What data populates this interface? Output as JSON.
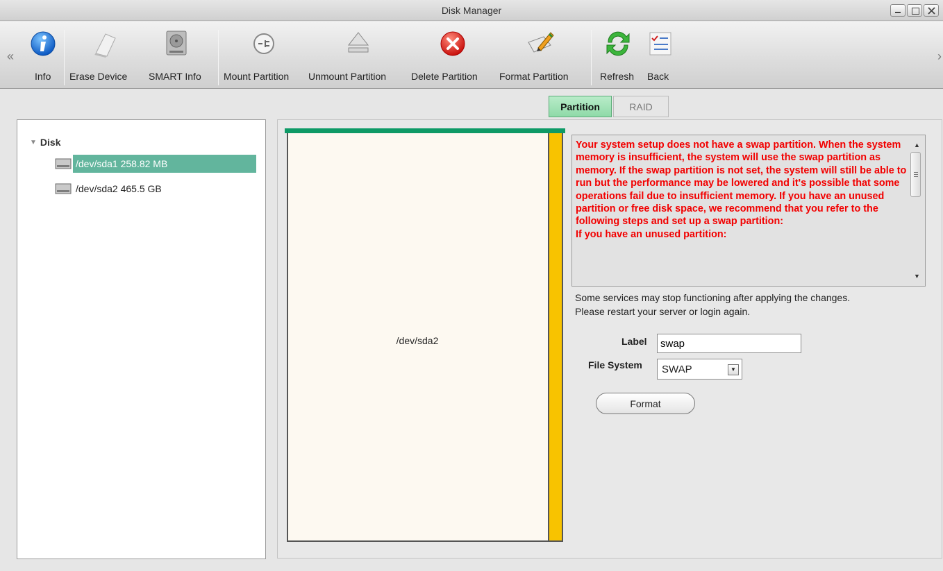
{
  "window": {
    "title": "Disk Manager"
  },
  "toolbar": {
    "prev_arrow": "«",
    "next_arrow": "›",
    "items": [
      {
        "label": "Info",
        "icon": "info-icon"
      },
      {
        "label": "Erase Device",
        "icon": "eraser-icon"
      },
      {
        "label": "SMART Info",
        "icon": "hard-disk-icon"
      },
      {
        "label": "Mount Partition",
        "icon": "plug-icon"
      },
      {
        "label": "Unmount Partition",
        "icon": "eject-icon"
      },
      {
        "label": "Delete Partition",
        "icon": "delete-icon"
      },
      {
        "label": "Format Partition",
        "icon": "format-pencil-icon"
      },
      {
        "label": "Refresh",
        "icon": "refresh-icon"
      },
      {
        "label": "Back",
        "icon": "checklist-icon"
      }
    ]
  },
  "tabs": [
    {
      "label": "Partition",
      "active": true
    },
    {
      "label": "RAID",
      "active": false
    }
  ],
  "tree": {
    "root": "Disk",
    "items": [
      {
        "label": "/dev/sda1 258.82 MB",
        "selected": true
      },
      {
        "label": "/dev/sda2 465.5 GB",
        "selected": false
      }
    ]
  },
  "partition_map": {
    "partition_name": "/dev/sda2",
    "used_color": "#f8c300",
    "bar_color": "#0e9a66"
  },
  "warning": {
    "text": "Your system setup does not have a swap partition. When the system memory is insufficient, the system will use the swap partition as memory. If the swap partition is not set, the system will still be able to run but the performance may be lowered and it's possible that some operations fail due to insufficient memory. If you have an unused partition or free disk space, we recommend that you refer to the following steps and set up a swap partition:",
    "text2": "If you have an unused partition:",
    "color": "#f20000"
  },
  "notice": {
    "line1": "Some services may stop functioning after applying the changes.",
    "line2": "Please restart your server or login again."
  },
  "form": {
    "label_caption": "Label",
    "label_value": "swap",
    "fs_caption": "File System",
    "fs_value": "SWAP",
    "format_button": "Format"
  }
}
